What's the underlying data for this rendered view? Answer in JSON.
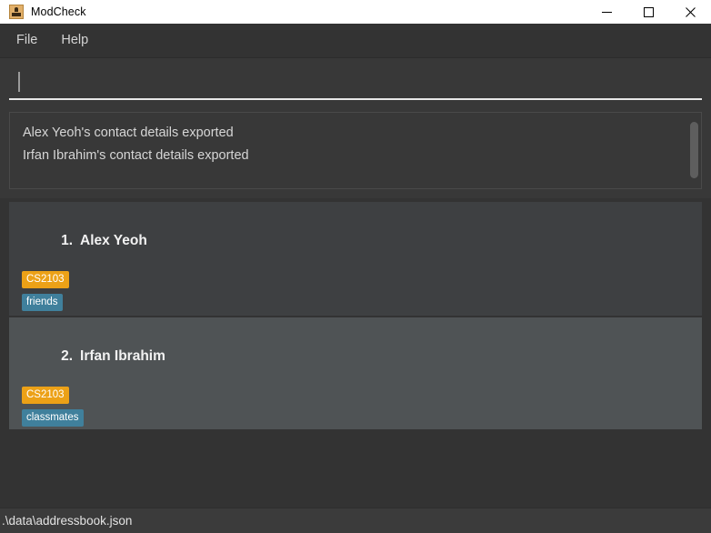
{
  "window": {
    "title": "ModCheck",
    "app_icon": "person-podium-icon",
    "controls": {
      "minimize": "minimize-icon",
      "maximize": "maximize-icon",
      "close": "close-icon"
    }
  },
  "menubar": {
    "items": [
      {
        "label": "File"
      },
      {
        "label": "Help"
      }
    ]
  },
  "command": {
    "value": "",
    "placeholder": ""
  },
  "result_display": {
    "lines": [
      "Alex Yeoh's contact details exported",
      "Irfan Ibrahim's contact details exported"
    ]
  },
  "person_list": {
    "cards": [
      {
        "index": "1.",
        "name": "Alex Yeoh",
        "selected": false,
        "tags": [
          {
            "label": "CS2103",
            "color": "#eca117"
          },
          {
            "label": "friends",
            "color": "#40809c"
          }
        ]
      },
      {
        "index": "2.",
        "name": "Irfan Ibrahim",
        "selected": true,
        "tags": [
          {
            "label": "CS2103",
            "color": "#eca117"
          },
          {
            "label": "classmates",
            "color": "#40809c"
          }
        ]
      }
    ]
  },
  "statusbar": {
    "path": ".\\data\\addressbook.json"
  },
  "colors": {
    "titlebar_bg": "#ffffff",
    "menubar_bg": "#333333",
    "app_bg": "#383838",
    "card_bg": "#3e4042",
    "card_selected_bg": "#4f5355",
    "tag_orange": "#eca117",
    "tag_blue": "#40809c",
    "text_primary": "#f2f2f2",
    "text_secondary": "#d6d6d6"
  }
}
